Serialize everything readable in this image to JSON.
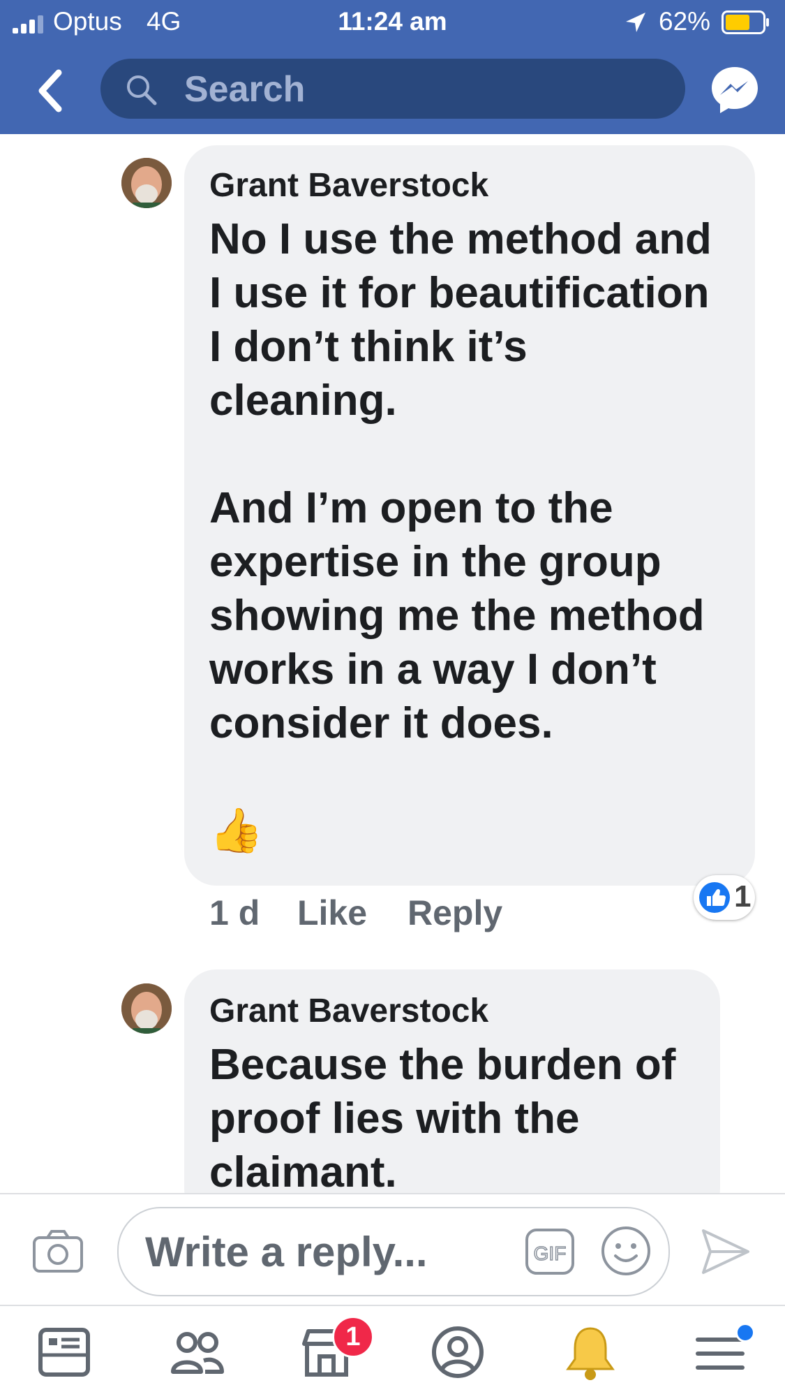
{
  "status_bar": {
    "carrier": "Optus",
    "network": "4G",
    "time": "11:24 am",
    "battery": "62%",
    "battery_level": 0.62,
    "icons": [
      "signal-icon",
      "location-arrow-icon",
      "battery-icon"
    ]
  },
  "nav": {
    "search_placeholder": "Search",
    "icons": [
      "back-chevron-icon",
      "search-icon",
      "messenger-icon"
    ]
  },
  "comments": [
    {
      "author": "Grant Baverstock",
      "text": "No I use the method and\nI use it for beautification\nI don’t think it’s\ncleaning.\n\nAnd I’m open to the\nexpertise in the group\nshowing me the method\nworks in a way I don’t\nconsider it does.\n\n👍",
      "time": "1 d",
      "like_label": "Like",
      "reply_label": "Reply",
      "reaction_count": "1"
    },
    {
      "author": "Grant Baverstock",
      "text": "Because the burden of\nproof lies with the\nclaimant."
    }
  ],
  "composer": {
    "placeholder": "Write a reply...",
    "gif_label": "GIF",
    "icons": [
      "camera-icon",
      "gif-icon",
      "smiley-icon",
      "send-icon"
    ]
  },
  "tabbar": {
    "tabs": [
      "news-feed-tab",
      "groups-tab",
      "marketplace-tab",
      "profile-tab",
      "notifications-tab",
      "menu-tab"
    ],
    "marketplace_badge": "1"
  },
  "colors": {
    "brand_blue": "#4267b2",
    "search_field": "#29487d",
    "bubble_bg": "#f0f1f3",
    "badge_red": "#f02849",
    "muted_text": "#606770"
  }
}
